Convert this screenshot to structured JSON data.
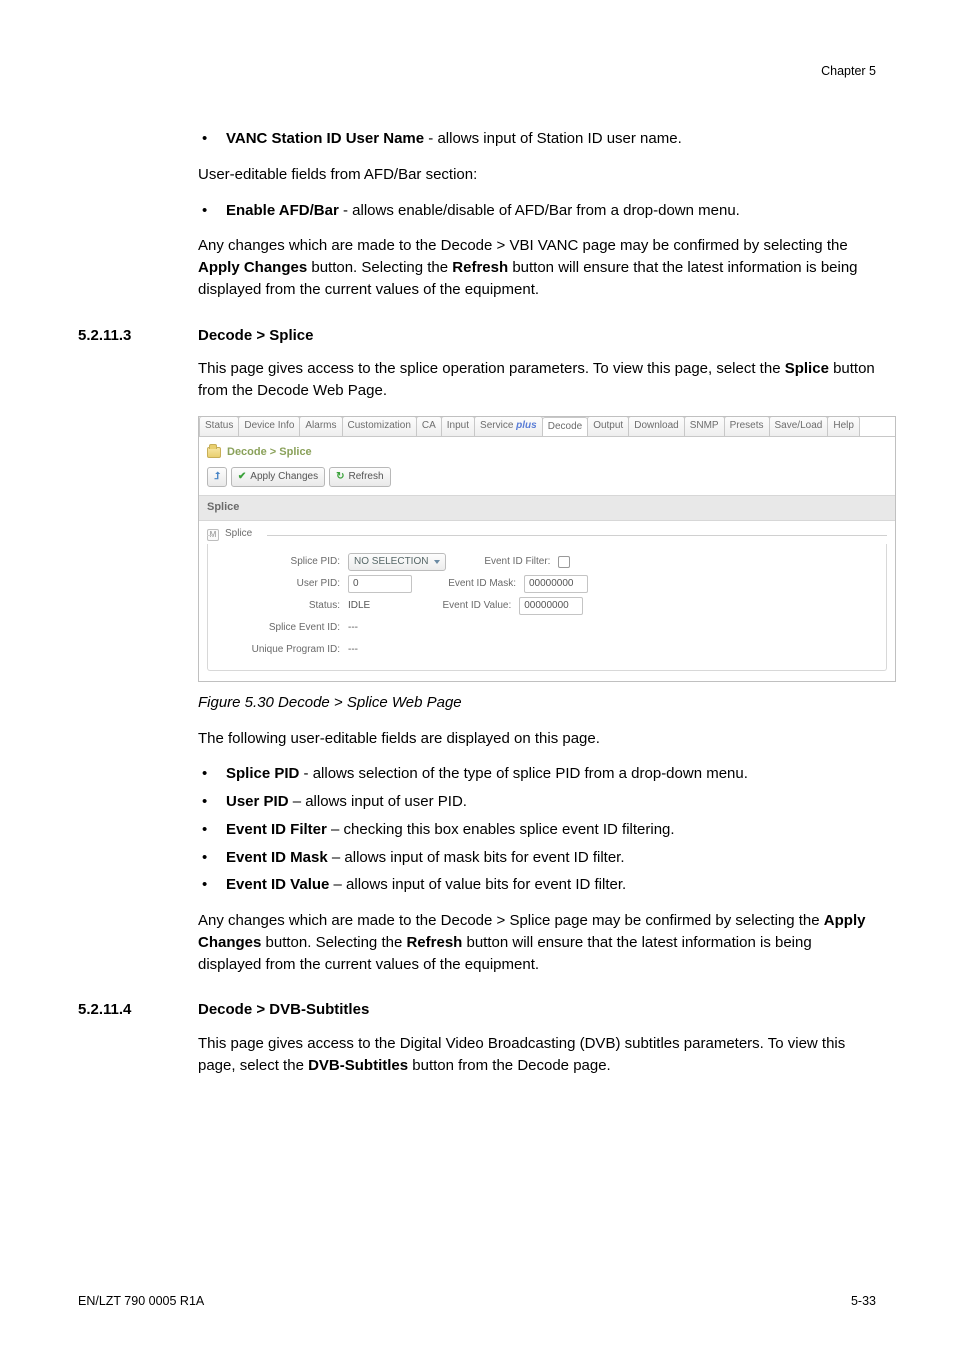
{
  "chapter": "Chapter 5",
  "section1": {
    "bullet1_bold": "VANC Station ID User Name",
    "bullet1_rest": " - allows input of Station ID user name.",
    "p1": "User-editable fields from AFD/Bar section:",
    "bullet2_bold": "Enable AFD/Bar",
    "bullet2_rest": " - allows enable/disable of AFD/Bar from a drop-down menu.",
    "p2_a": "Any changes which are made to the Decode > VBI VANC page may be confirmed by selecting the ",
    "p2_b_bold": "Apply Changes",
    "p2_c": " button. Selecting the ",
    "p2_d_bold": "Refresh",
    "p2_e": " button will ensure that the latest information is being displayed from the current values of the equipment."
  },
  "h1": {
    "num": "5.2.11.3",
    "title": "Decode > Splice"
  },
  "splice_intro_a": "This page gives access to the splice operation parameters. To view this page, select the ",
  "splice_intro_bold": "Splice",
  "splice_intro_b": " button from the Decode Web Page.",
  "shot": {
    "tabs": [
      "Status",
      "Device Info",
      "Alarms",
      "Customization",
      "CA",
      "Input",
      "Service plus",
      "Decode",
      "Output",
      "Download",
      "SNMP",
      "Presets",
      "Save/Load",
      "Help"
    ],
    "active_tab_index": 7,
    "breadcrumb": "Decode > Splice",
    "toolbar": {
      "apply": "Apply Changes",
      "refresh": "Refresh"
    },
    "section_title": "Splice",
    "group_title": "Splice",
    "group_collapse_glyph": "M",
    "rows": {
      "splice_pid_label": "Splice PID:",
      "splice_pid_value": "NO SELECTION",
      "user_pid_label": "User PID:",
      "user_pid_value": "0",
      "status_label": "Status:",
      "status_value": "IDLE",
      "splice_event_label": "Splice Event ID:",
      "splice_event_value": "---",
      "unique_prog_label": "Unique Program ID:",
      "unique_prog_value": "---",
      "evt_filter_label": "Event ID Filter:",
      "evt_mask_label": "Event ID Mask:",
      "evt_mask_value": "00000000",
      "evt_value_label": "Event ID Value:",
      "evt_value_value": "00000000"
    }
  },
  "fig_caption": "Figure 5.30 Decode > Splice Web Page",
  "splice_fields_intro": "The following user-editable fields are displayed on this page.",
  "splice_bullets": [
    {
      "bold": "Splice PID",
      "rest": " - allows selection of the type of splice PID from a drop-down menu."
    },
    {
      "bold": "User PID",
      "rest": " – allows input of user PID."
    },
    {
      "bold": "Event ID Filter",
      "rest": " – checking this box enables splice event ID filtering."
    },
    {
      "bold": "Event ID Mask",
      "rest": " – allows input of mask bits for event ID filter."
    },
    {
      "bold": "Event ID Value",
      "rest": " – allows input of value bits for event ID filter."
    }
  ],
  "splice_outro_a": "Any changes which are made to the Decode > Splice page may be confirmed by selecting the ",
  "splice_outro_b_bold": "Apply Changes",
  "splice_outro_c": " button. Selecting the ",
  "splice_outro_d_bold": "Refresh",
  "splice_outro_e": " button will ensure that the latest information is being displayed from the current values of the equipment.",
  "h2": {
    "num": "5.2.11.4",
    "title": "Decode > DVB-Subtitles"
  },
  "dvb_a": "This page gives access to the Digital Video Broadcasting (DVB) subtitles parameters. To view this page, select the ",
  "dvb_bold": "DVB-Subtitles",
  "dvb_b": " button from the Decode page.",
  "footer": {
    "left": "EN/LZT 790 0005 R1A",
    "right": "5-33"
  }
}
